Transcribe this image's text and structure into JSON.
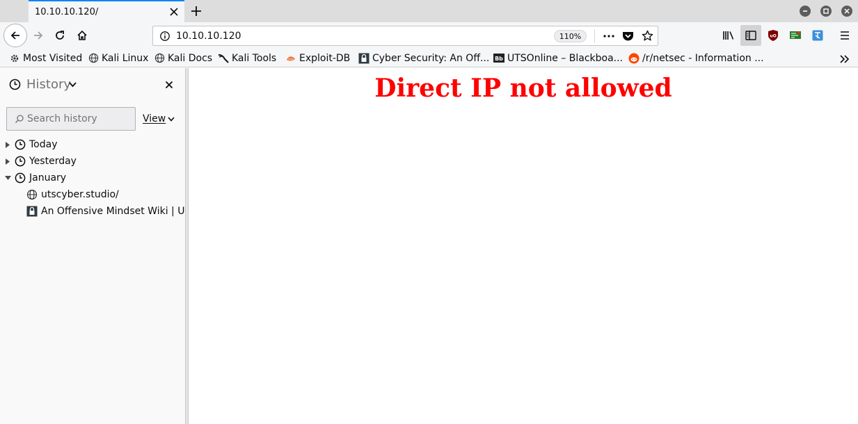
{
  "tab": {
    "title": "10.10.10.120/"
  },
  "navbar": {
    "url": "10.10.10.120",
    "zoom": "110%"
  },
  "bookmarks": [
    {
      "label": "Most Visited",
      "icon": "gear-icon"
    },
    {
      "label": "Kali Linux",
      "icon": "globe-icon"
    },
    {
      "label": "Kali Docs",
      "icon": "globe-icon"
    },
    {
      "label": "Kali Tools",
      "icon": "kali-dragon-icon"
    },
    {
      "label": "Exploit-DB",
      "icon": "exploit-db-icon"
    },
    {
      "label": "Cyber Security: An Off...",
      "icon": "lock-site-icon"
    },
    {
      "label": "UTSOnline – Blackboa...",
      "icon": "blackboard-icon"
    },
    {
      "label": "/r/netsec - Information ...",
      "icon": "reddit-icon"
    }
  ],
  "sidebar": {
    "title": "History",
    "search_placeholder": "Search history",
    "view_label": "View",
    "groups": [
      {
        "label": "Today",
        "expanded": false
      },
      {
        "label": "Yesterday",
        "expanded": false
      },
      {
        "label": "January",
        "expanded": true
      }
    ],
    "entries": [
      {
        "label": "utscyber.studio/",
        "icon": "globe-icon"
      },
      {
        "label": "An Offensive Mindset Wiki | U...",
        "icon": "lock-site-icon"
      }
    ]
  },
  "page": {
    "headline": "Direct IP not allowed",
    "headline_color": "#ff0000"
  },
  "colors": {
    "accent": "#0a84ff"
  }
}
